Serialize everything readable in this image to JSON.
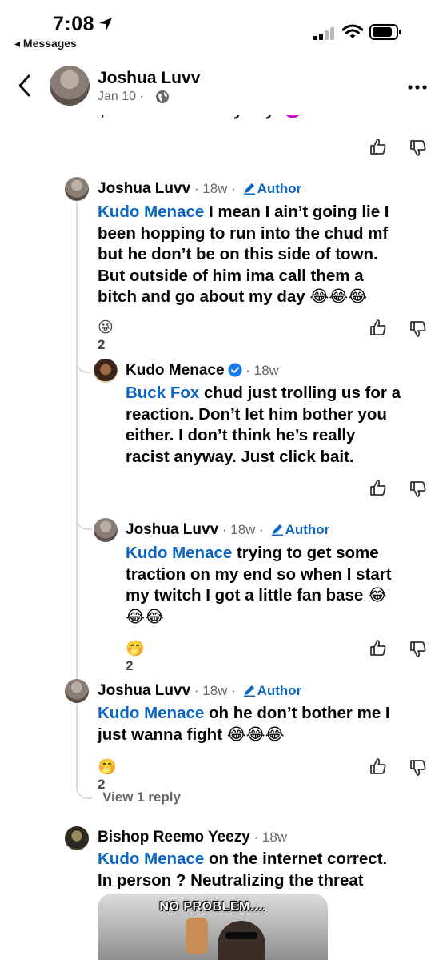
{
  "status": {
    "time": "7:08",
    "back_label": "◂ Messages"
  },
  "header": {
    "name": "Joshua Luvv",
    "date": "Jan 10 ·"
  },
  "cut_text": "me it, cuz I use em anyway. 👿",
  "comments": [
    {
      "name": "Joshua Luvv",
      "dot": " · ",
      "ago": "18w",
      "dot2": " · ",
      "author": "Author",
      "mention": "Kudo Menace",
      "lines": [
        " I mean I ain’t going lie I",
        "been hopping to run into the chud mf",
        "but he don’t be on this side of town.",
        "But outside of him ima call them a",
        "bitch and go about my day 😂😂😂"
      ],
      "reaction_emoji": "😜",
      "reaction_count": "2"
    },
    {
      "name": "Kudo Menace",
      "dot": " · ",
      "ago": "18w",
      "mention": "Buck Fox",
      "lines": [
        " chud just trolling us for a",
        "reaction. Don’t let him bother you",
        "either. I don’t think he’s really",
        "racist anyway. Just click bait."
      ]
    },
    {
      "name": "Joshua Luvv",
      "dot": " · ",
      "ago": "18w",
      "dot2": " · ",
      "author": "Author",
      "mention": "Kudo Menace",
      "lines": [
        " trying to get some",
        "traction on my end so when I start",
        "my twitch I got a little fan base 😂",
        "😂😂"
      ],
      "reaction_emoji": "🤭",
      "reaction_count": "2"
    },
    {
      "name": "Joshua Luvv",
      "dot": " · ",
      "ago": "18w",
      "dot2": " · ",
      "author": "Author",
      "mention": "Kudo Menace",
      "lines": [
        " oh he don’t bother me I",
        "just wanna fight 😂😂😂"
      ],
      "reaction_emoji": "🤭",
      "reaction_count": "2"
    },
    {
      "name": "Bishop Reemo Yeezy",
      "dot": " · ",
      "ago": "18w",
      "mention": "Kudo Menace",
      "lines": [
        " on the internet correct.",
        "In person ? Neutralizing the threat"
      ]
    }
  ],
  "view_reply": "View 1 reply",
  "gif_caption": "NO PROBLEM...."
}
